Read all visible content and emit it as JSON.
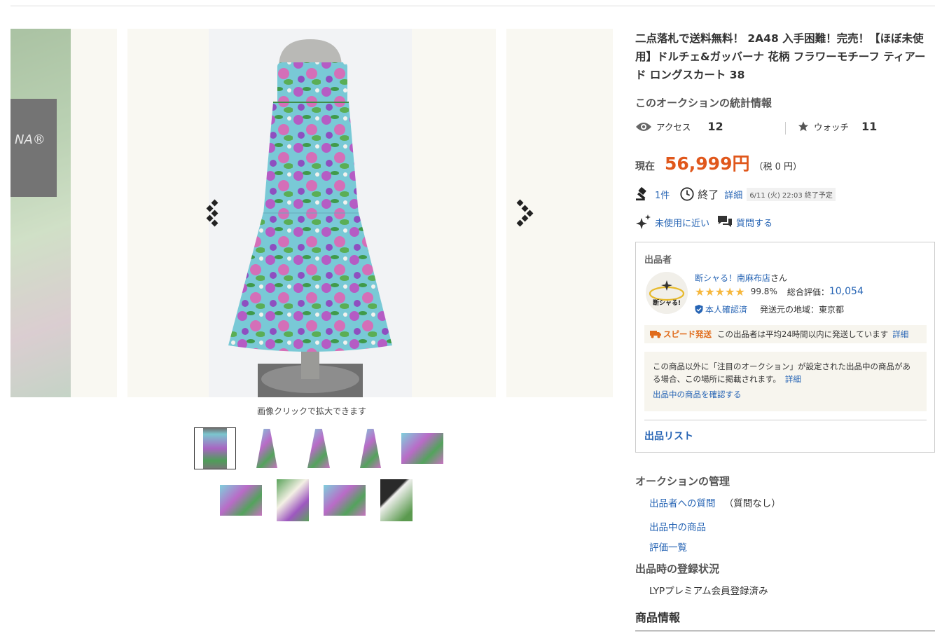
{
  "gallery": {
    "zoom_hint": "画像クリックで拡大できます",
    "left_label_text": "NA®",
    "prev_label": "前の画像",
    "next_label": "次の画像"
  },
  "product": {
    "title": "二点落札で送料無料！ 2A48 入手困難！完売！【ほぼ未使用】ドルチェ&ガッバーナ 花柄 フラワーモチーフ ティアード ロングスカート 38"
  },
  "stats": {
    "heading": "このオークションの統計情報",
    "access_label": "アクセス",
    "access_value": "12",
    "watch_label": "ウォッチ",
    "watch_value": "11"
  },
  "price": {
    "label": "現在",
    "value": "56,999円",
    "tax": "（税 0 円）"
  },
  "bid": {
    "count": "1件",
    "status": "終了",
    "detail": "詳細",
    "end_date": "6/11 (火) 22:03 終了予定"
  },
  "condition": {
    "label": "未使用に近い",
    "question": "質問する"
  },
  "seller": {
    "heading": "出品者",
    "name": "断シャる！南麻布店",
    "suffix": "さん",
    "stars": "★★★★★",
    "rating_pct": "99.8%",
    "rating_label": "総合評価：",
    "rating_count": "10,054",
    "verified": "本人確認済",
    "region": "発送元の地域：東京都",
    "avatar_text": "断シャる!",
    "speed_tag": "スピード発送",
    "speed_text": "この出品者は平均24時間以内に発送しています",
    "speed_detail": "詳細",
    "attn_text": "この商品以外に「注目のオークション」が設定された出品中の商品がある場合、この場所に掲載されます。",
    "attn_detail": "詳細",
    "attn_link": "出品中の商品を確認する",
    "list_link": "出品リスト"
  },
  "manage": {
    "heading": "オークションの管理",
    "question_link": "出品者への質問",
    "question_note": "（質問なし）",
    "listing_link": "出品中の商品",
    "review_link": "評価一覧"
  },
  "registration": {
    "heading": "出品時の登録状況",
    "value": "LYPプレミアム会員登録済み"
  },
  "product_info": {
    "heading": "商品情報"
  },
  "colors": {
    "accent": "#e0571b",
    "link": "#2664b4",
    "star": "#f6b73c"
  }
}
